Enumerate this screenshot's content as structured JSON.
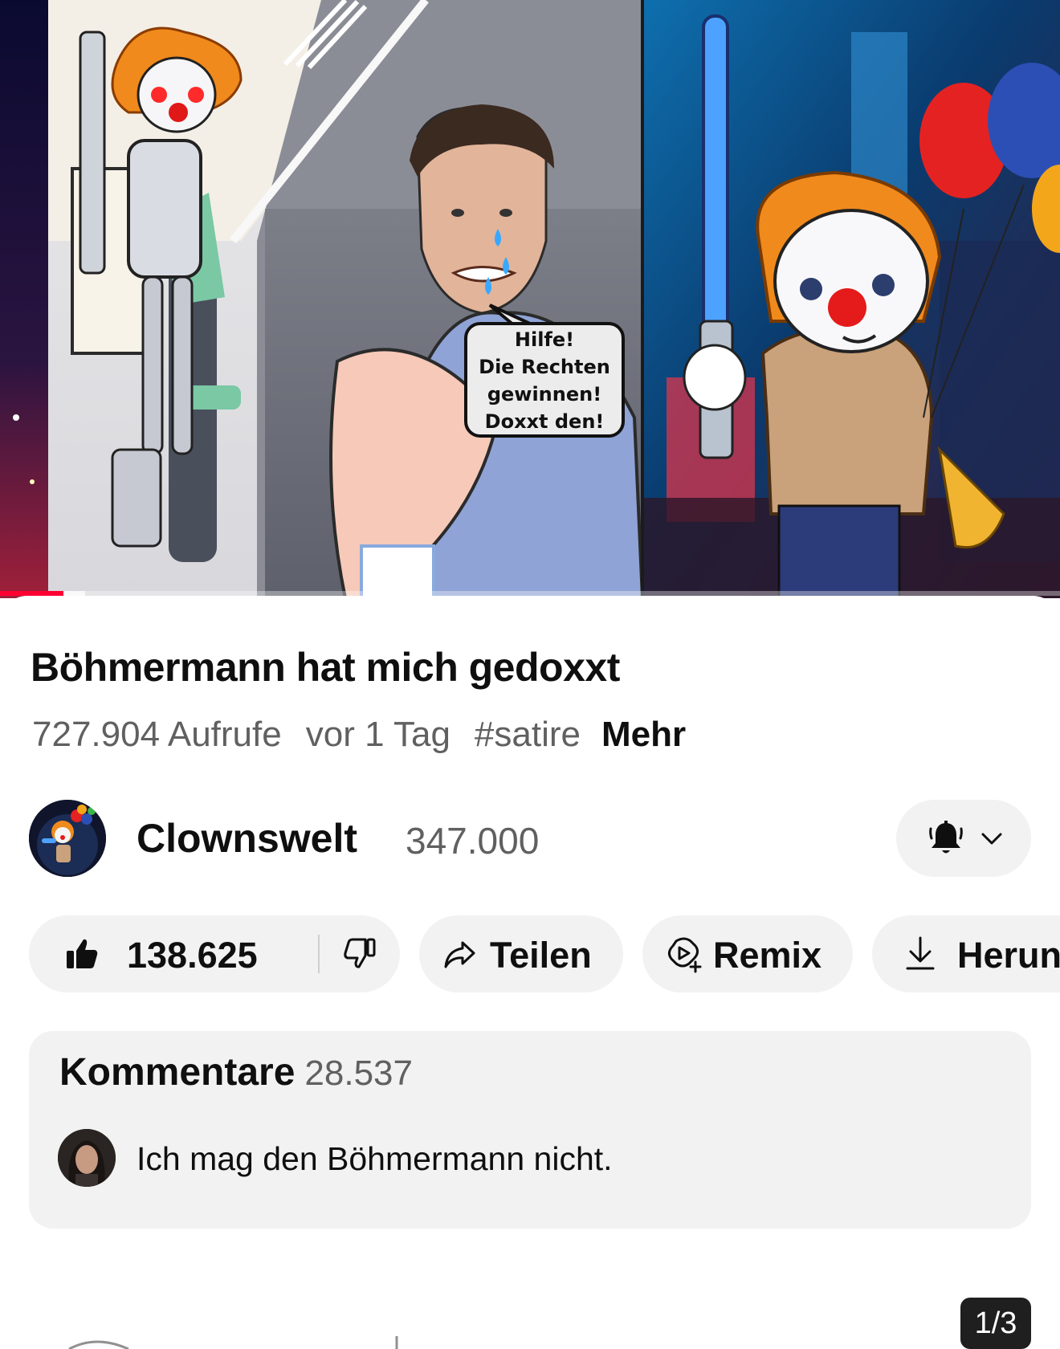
{
  "video": {
    "speech_bubble": [
      "Hilfe!",
      "Die Rechten",
      "gewinnen!",
      "Doxxt den!"
    ],
    "progress_fraction": 0.06,
    "buffer_fraction": 0.08,
    "progress_color": "#ff0033"
  },
  "title": "Böhmermann hat mich gedoxxt",
  "meta": {
    "views": "727.904 Aufrufe",
    "age": "vor 1 Tag",
    "hashtag": "#satire",
    "more": "Mehr"
  },
  "channel": {
    "name": "Clownswelt",
    "subscribers": "347.000",
    "bell_icon": "bell-filled-icon",
    "chevron_icon": "chevron-down-icon"
  },
  "actions": {
    "like_count": "138.625",
    "share": "Teilen",
    "remix": "Remix",
    "download": "Herunterladen"
  },
  "comments": {
    "heading": "Kommentare",
    "count": "28.537",
    "top_comment": "Ich mag den Böhmermann nicht."
  },
  "page_indicator": "1/3",
  "colors": {
    "pill_bg": "#f2f2f2",
    "secondary_text": "#606060",
    "primary_text": "#0f0f0f"
  }
}
